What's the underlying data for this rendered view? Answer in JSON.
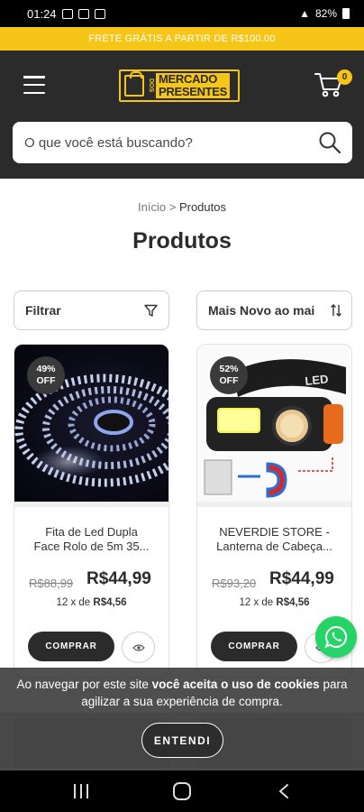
{
  "status_bar": {
    "time": "01:24",
    "battery": "82%"
  },
  "promo": {
    "text": "FRETE GRÁTIS A PARTIR DE R$100.00"
  },
  "header": {
    "logo_line1": "MERCADO",
    "logo_line2": "PRESENTES",
    "logo_prefix": "DOS",
    "cart_count": "0",
    "search_placeholder": "O que você está buscando?"
  },
  "breadcrumb": {
    "home": "Início",
    "separator": ">",
    "current": "Produtos"
  },
  "page_title": "Produtos",
  "controls": {
    "filter_label": "Filtrar",
    "sort_label": "Mais Novo ao mai"
  },
  "products": [
    {
      "discount_pct": "49%",
      "discount_off": "OFF",
      "name_line1": "Fita de Led Dupla",
      "name_line2": "Face Rolo de 5m 35...",
      "old_price": "R$88,99",
      "new_price": "R$44,99",
      "installments_prefix": "12 x de",
      "installment_value": "R$4,56",
      "buy_label": "COMPRAR"
    },
    {
      "discount_pct": "52%",
      "discount_off": "OFF",
      "name_line1": "NEVERDIE STORE -",
      "name_line2": "Lanterna de Cabeça...",
      "old_price": "R$93,20",
      "new_price": "R$44,99",
      "installments_prefix": "12 x de",
      "installment_value": "R$4,56",
      "buy_label": "COMPRAR"
    }
  ],
  "cookie": {
    "text_before": "Ao navegar por este site ",
    "text_bold": "você aceita o uso de cookies",
    "text_after": " para agilizar a sua experiência de compra.",
    "button_label": "ENTENDI"
  },
  "colors": {
    "accent": "#f5c518",
    "header_bg": "#2b2b2b",
    "whatsapp": "#25d366"
  },
  "icons": [
    "hamburger-icon",
    "cart-icon",
    "search-icon",
    "filter-icon",
    "sort-icon",
    "eye-icon",
    "whatsapp-icon"
  ]
}
